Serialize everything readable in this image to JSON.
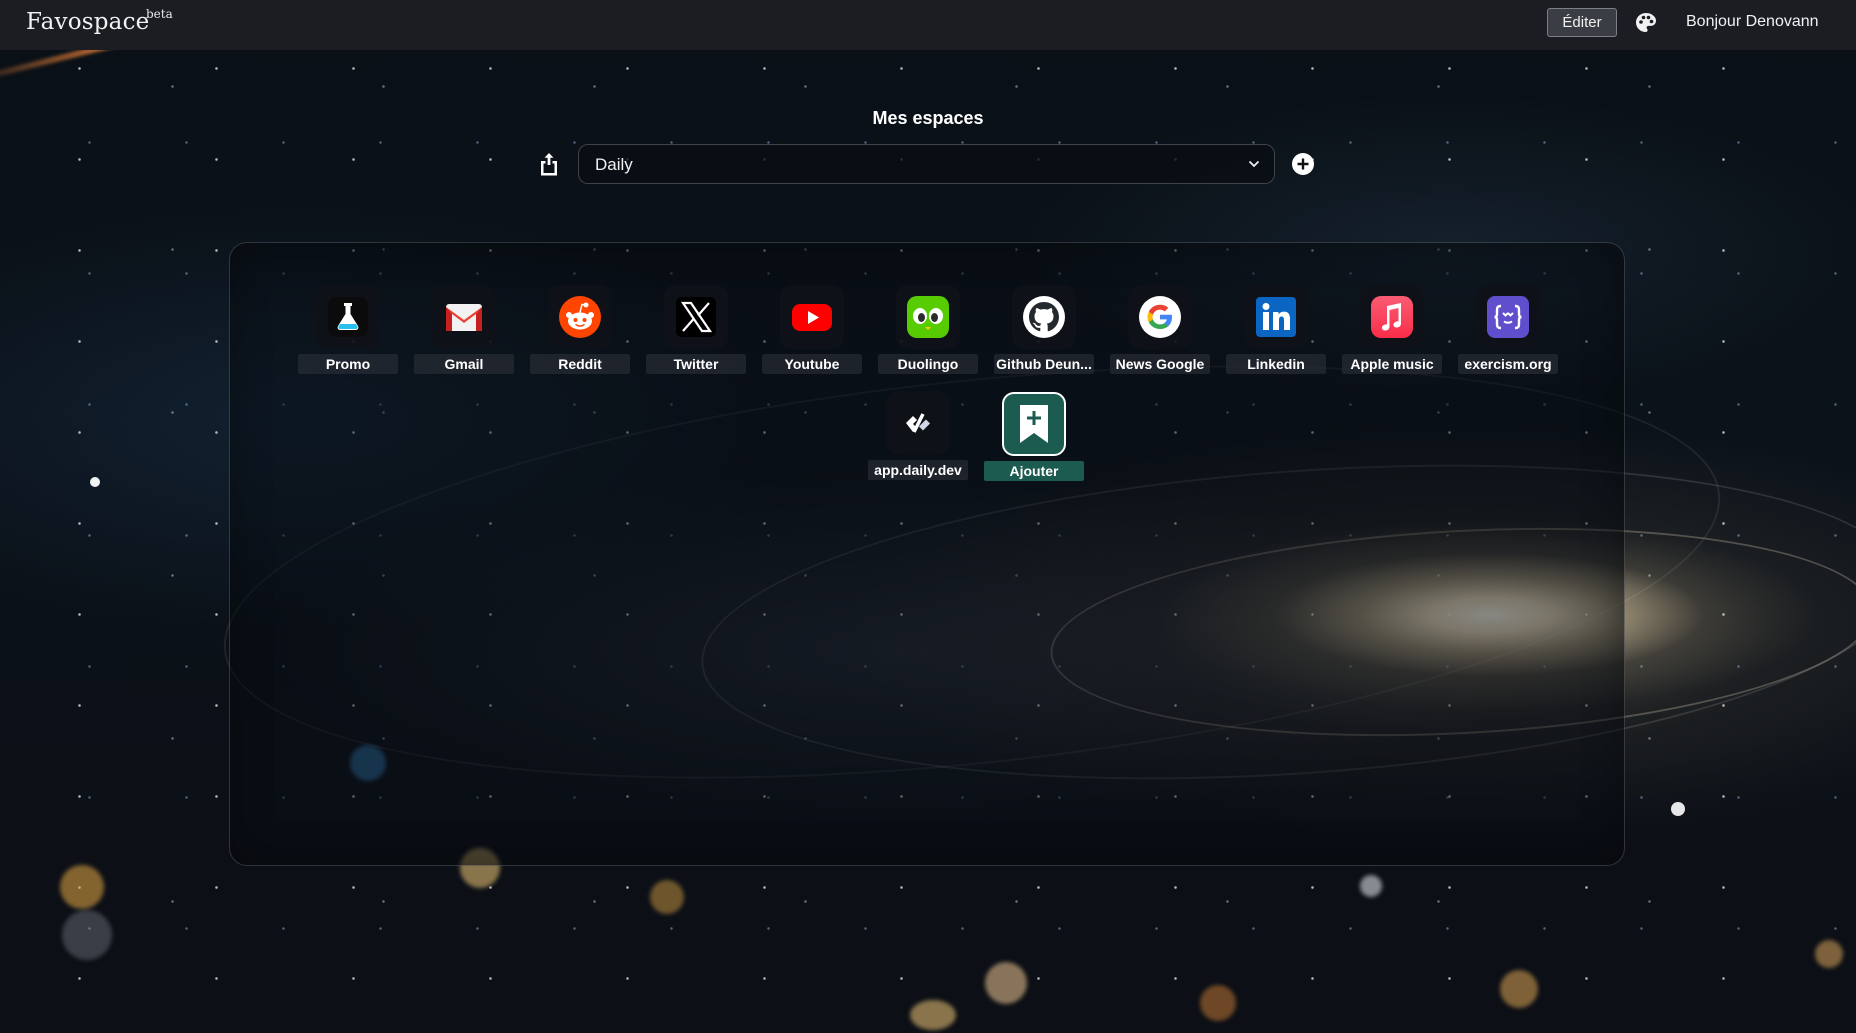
{
  "app": {
    "brand": "Favospace",
    "beta": "beta",
    "edit_label": "Éditer",
    "greeting": "Bonjour Denovann"
  },
  "spaces": {
    "title": "Mes espaces",
    "selected": "Daily"
  },
  "bookmarks": [
    {
      "label": "Promo",
      "icon": "flask-icon",
      "color": "#000000"
    },
    {
      "label": "Gmail",
      "icon": "gmail-icon",
      "color": "#EA4335"
    },
    {
      "label": "Reddit",
      "icon": "reddit-icon",
      "color": "#FF4500"
    },
    {
      "label": "Twitter",
      "icon": "x-icon",
      "color": "#000000"
    },
    {
      "label": "Youtube",
      "icon": "youtube-icon",
      "color": "#FF0000"
    },
    {
      "label": "Duolingo",
      "icon": "duolingo-icon",
      "color": "#58CC02"
    },
    {
      "label": "Github Deun...",
      "icon": "github-icon",
      "color": "#24292e"
    },
    {
      "label": "News Google",
      "icon": "google-icon",
      "color": "#4285F4"
    },
    {
      "label": "Linkedin",
      "icon": "linkedin-icon",
      "color": "#0A66C2"
    },
    {
      "label": "Apple music",
      "icon": "apple-music-icon",
      "color": "#FA2D48"
    },
    {
      "label": "exercism.org",
      "icon": "exercism-icon",
      "color": "#604FCD"
    },
    {
      "label": "app.daily.dev",
      "icon": "daily-dev-icon",
      "color": "#0E1217"
    }
  ],
  "add_tile": {
    "label": "Ajouter",
    "icon": "bookmark-plus-icon",
    "color": "#1C5B4F"
  }
}
